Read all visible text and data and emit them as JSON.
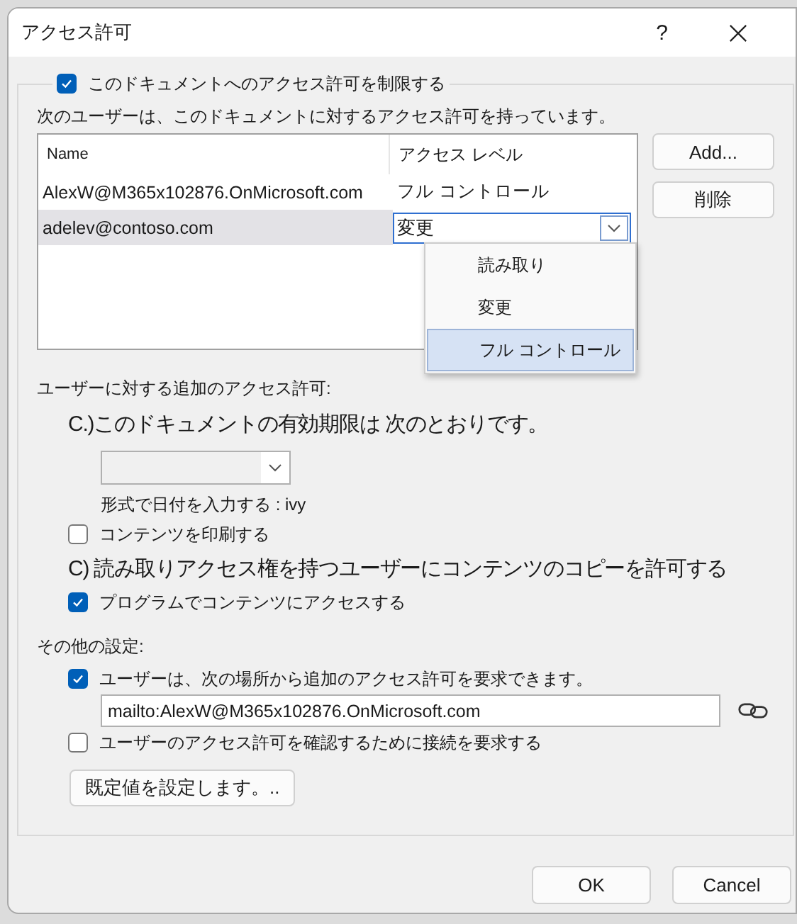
{
  "window": {
    "title": "アクセス許可",
    "help": "?"
  },
  "restrict": {
    "label": "このドキュメントへのアクセス許可を制限する",
    "checked": true
  },
  "users_caption": "次のユーザーは、このドキュメントに対するアクセス許可を持っています。",
  "users_table": {
    "columns": [
      "Name",
      "アクセス レベル"
    ],
    "rows": [
      {
        "name": "AlexW@M365x102876.OnMicrosoft.com",
        "access": "フル コントロール",
        "selected": false
      },
      {
        "name": "adelev@contoso.com",
        "access": "変更",
        "selected": true
      }
    ]
  },
  "access_menu": {
    "options": [
      {
        "label": "読み取り",
        "selected": false
      },
      {
        "label": "変更",
        "selected": false
      },
      {
        "label": "フル コントロール",
        "selected": true
      }
    ]
  },
  "side_buttons": [
    "Add...",
    "削除"
  ],
  "additional": {
    "heading": "ユーザーに対する追加のアクセス許可:",
    "expiry_label": "C.)このドキュメントの有効期限は 次のとおりです。",
    "date_hint": "形式で日付を入力する : ivy",
    "print": {
      "label": "コンテンツを印刷する",
      "checked": false
    },
    "copy_label": "C) 読み取りアクセス権を持つユーザーにコンテンツのコピーを許可する",
    "program": {
      "label": "プログラムでコンテンツにアクセスする",
      "checked": true
    }
  },
  "other": {
    "heading": "その他の設定:",
    "request": {
      "label": "ユーザーは、次の場所から追加のアクセス許可を要求できます。",
      "checked": true
    },
    "request_address": "mailto:AlexW@M365x102876.OnMicrosoft.com",
    "connect": {
      "label": "ユーザーのアクセス許可を確認するために接続を要求する",
      "checked": false
    },
    "defaults_button": "既定値を設定します。.."
  },
  "buttons": [
    "OK",
    "Cancel"
  ]
}
